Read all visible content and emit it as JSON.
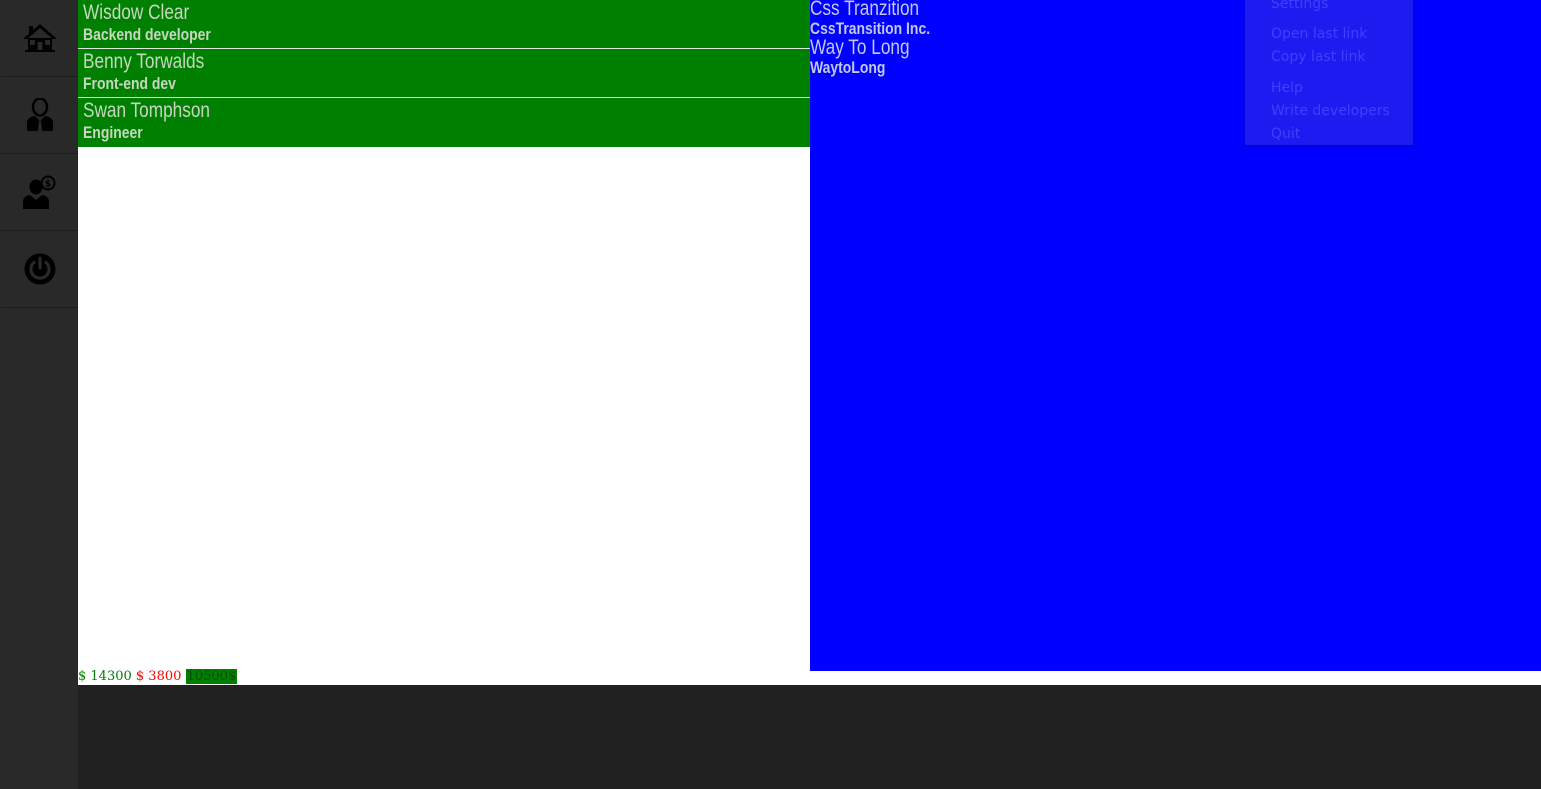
{
  "sidebar": {
    "items": [
      {
        "icon": "home-icon"
      },
      {
        "icon": "user-icon"
      },
      {
        "icon": "salary-user-icon"
      },
      {
        "icon": "power-icon"
      }
    ]
  },
  "employees": [
    {
      "name": "Wisdow Clear",
      "role": "Backend developer"
    },
    {
      "name": "Benny Torwalds",
      "role": "Front-end dev"
    },
    {
      "name": "Swan Tomphson",
      "role": "Engineer"
    }
  ],
  "companies": [
    {
      "name": "Css Tranzition",
      "sub": "CssTransition Inc."
    },
    {
      "name": "Way To Long",
      "sub": "WaytoLong"
    }
  ],
  "menu": {
    "items": [
      "Settings",
      "Open last link",
      "Copy last link",
      "Help",
      "Write developers",
      "Quit"
    ]
  },
  "totals": {
    "income": "$ 14300",
    "expense": "$ 3800",
    "balance": "10500$"
  },
  "colors": {
    "list_bg": "#008000",
    "panel_bg": "#0000ff",
    "sidebar_bg": "#292929"
  }
}
